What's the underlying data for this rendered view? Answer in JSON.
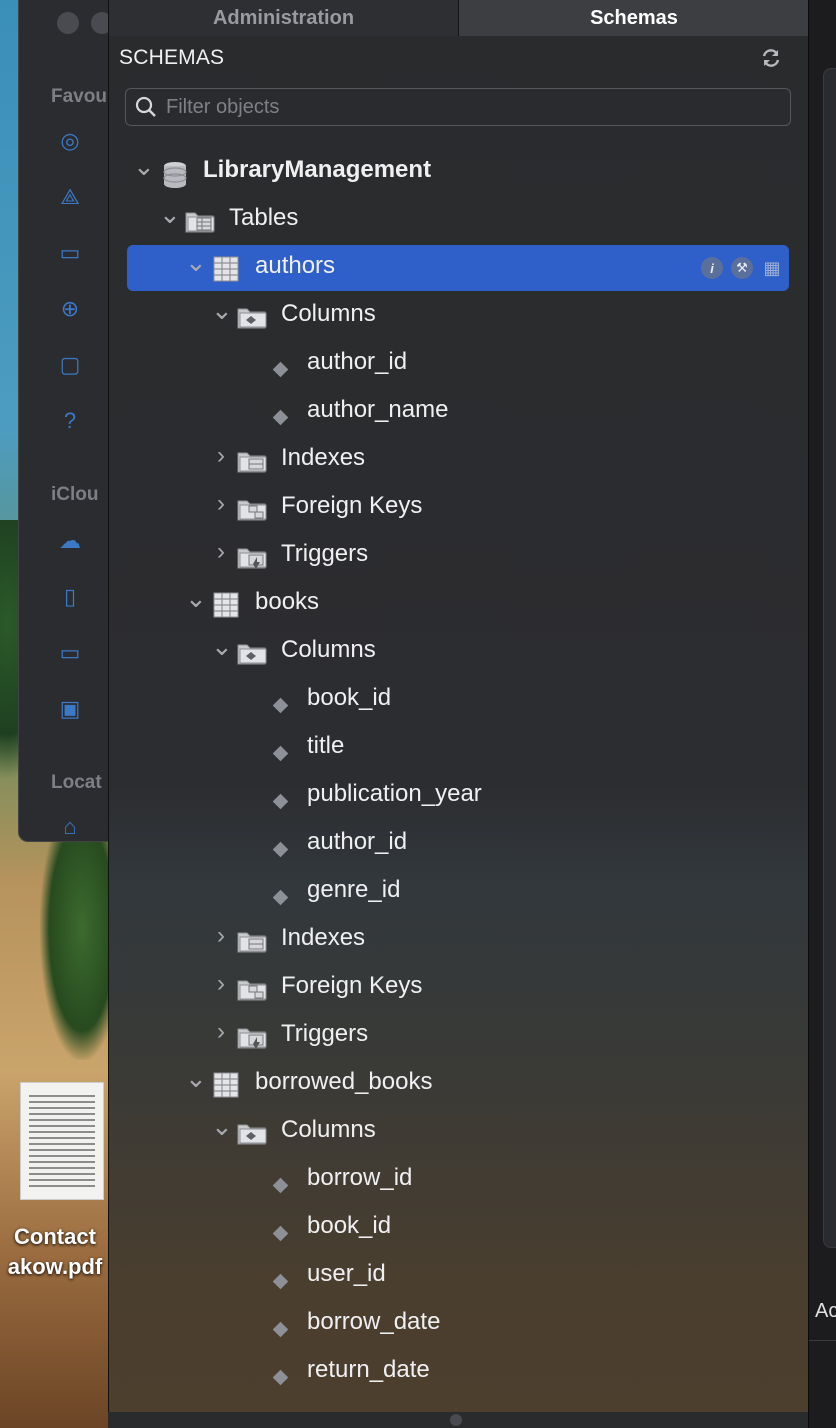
{
  "tabs": [
    {
      "label": "Administration"
    },
    {
      "label": "Schemas"
    }
  ],
  "panel": {
    "title": "SCHEMAS",
    "filter": {
      "placeholder": "Filter objects",
      "value": ""
    }
  },
  "tree": {
    "schema": "LibraryManagement",
    "tables_label": "Tables",
    "tables": [
      {
        "name": "authors",
        "selected": true,
        "columns_label": "Columns",
        "columns": [
          "author_id",
          "author_name"
        ],
        "groups": [
          "Indexes",
          "Foreign Keys",
          "Triggers"
        ]
      },
      {
        "name": "books",
        "selected": false,
        "columns_label": "Columns",
        "columns": [
          "book_id",
          "title",
          "publication_year",
          "author_id",
          "genre_id"
        ],
        "groups": [
          "Indexes",
          "Foreign Keys",
          "Triggers"
        ]
      },
      {
        "name": "borrowed_books",
        "selected": false,
        "columns_label": "Columns",
        "columns": [
          "borrow_id",
          "book_id",
          "user_id",
          "borrow_date",
          "return_date"
        ],
        "groups": []
      }
    ]
  },
  "finder_sidebar": {
    "sections": [
      "Favou",
      "iClou",
      "Locat"
    ]
  },
  "desktop": {
    "file_label_line1": "Contact",
    "file_label_line2": "akow.pdf"
  },
  "right_edge": {
    "label": "Ac"
  },
  "colors": {
    "selection": "#2f5fc8",
    "panel_bg": "#2a2b2d",
    "accent_icon": "#3b78c5"
  },
  "icons": {
    "schema": "database-icon",
    "tables": "tables-folder-icon",
    "table": "table-icon",
    "columns": "columns-folder-icon",
    "indexes": "indexes-folder-icon",
    "foreign_keys": "foreign-keys-folder-icon",
    "triggers": "triggers-folder-icon",
    "column": "column-diamond-icon"
  }
}
